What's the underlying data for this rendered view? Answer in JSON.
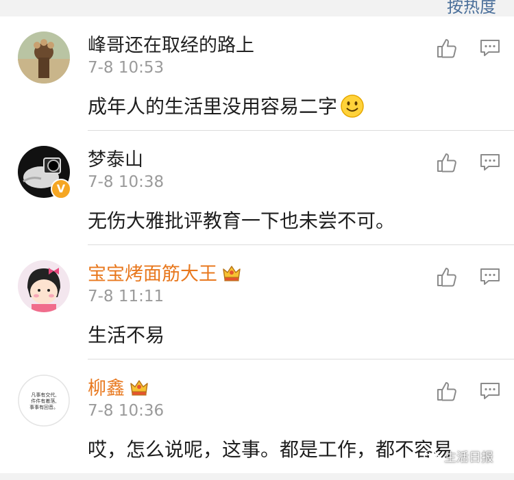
{
  "header": {
    "sort_label": "按热度"
  },
  "colors": {
    "vip_name": "#e8781e",
    "verified_badge": "#f5a623",
    "meta": "#9a9a9a"
  },
  "comments": [
    {
      "name": "峰哥还在取经的路上",
      "time": "7-8 10:53",
      "text": "成年人的生活里没用容易二字",
      "emoji": "smile-emoji",
      "vip": false
    },
    {
      "name": "梦泰山",
      "time": "7-8 10:38",
      "text": "无伤大雅批评教育一下也未尝不可。",
      "verified": true,
      "vip": false
    },
    {
      "name": "宝宝烤面筋大王",
      "time": "7-8 11:11",
      "text": "生活不易",
      "vip": true
    },
    {
      "name": "柳鑫",
      "time": "7-8 10:36",
      "text": "哎，怎么说呢，这事。都是工作，都不容易",
      "vip": true,
      "avatar_text": [
        "凡事有交代,",
        "件件有着落,",
        "事事有回音。"
      ]
    }
  ],
  "watermark": {
    "text": "生活日报"
  }
}
